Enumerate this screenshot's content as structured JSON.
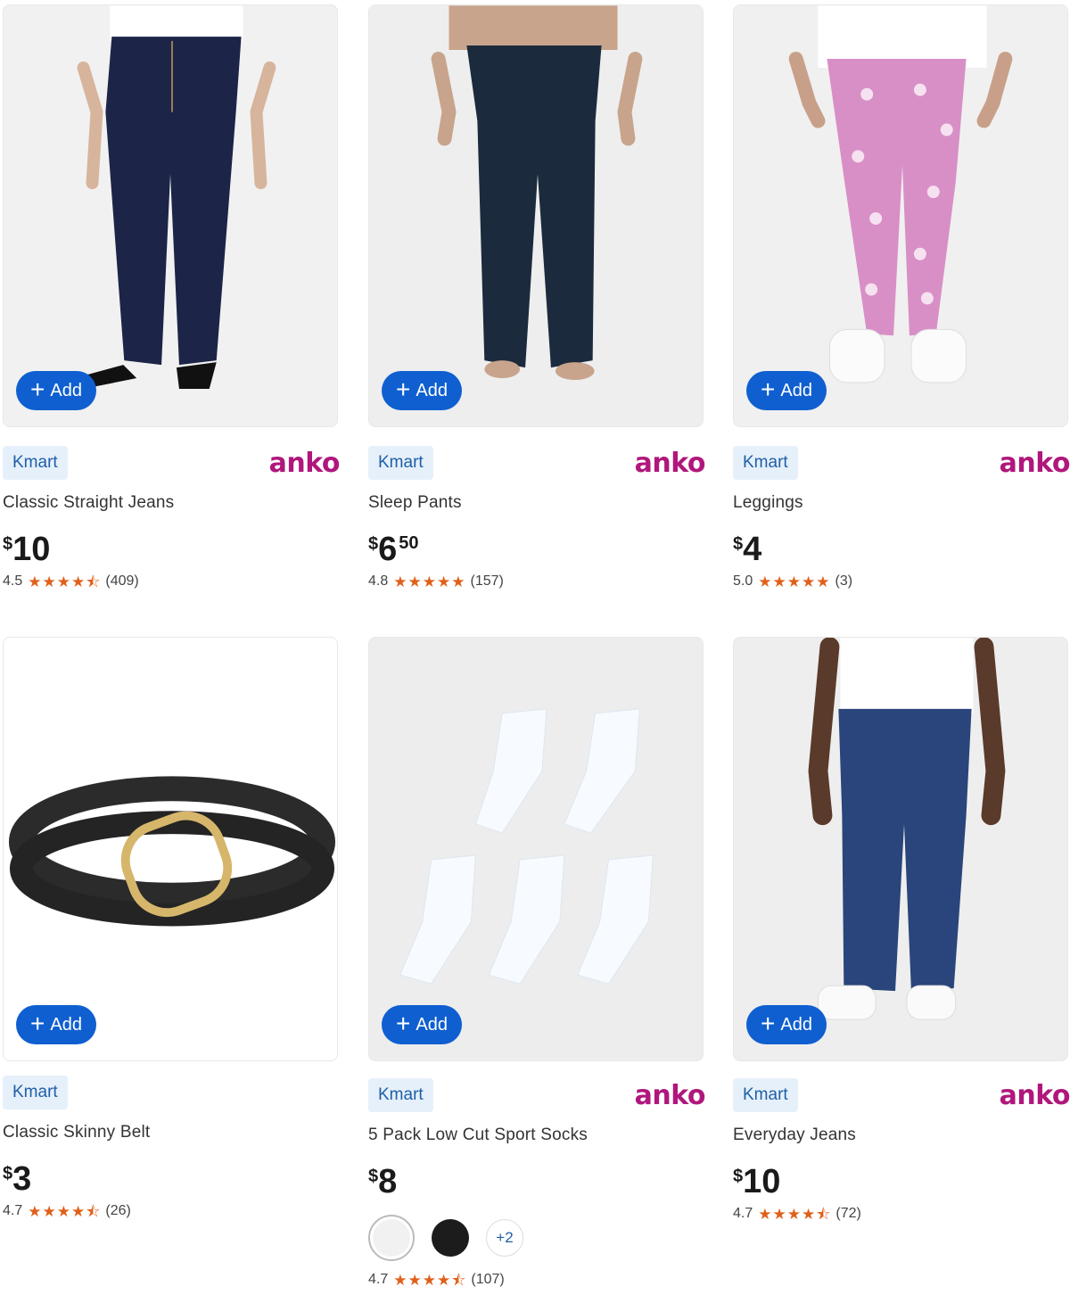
{
  "accent_color": "#0f5fd0",
  "brand_color": "#b0177c",
  "star_color": "#e0601a",
  "products": [
    {
      "add_label": "Add",
      "store": "Kmart",
      "brand": "anko",
      "title": "Classic Straight Jeans",
      "price_currency": "$",
      "price_dollars": "10",
      "price_cents": "",
      "rating": "4.5",
      "stars": 4.5,
      "reviews": "(409)",
      "image_icon": "womens-jeans-image"
    },
    {
      "add_label": "Add",
      "store": "Kmart",
      "brand": "anko",
      "title": "Sleep Pants",
      "price_currency": "$",
      "price_dollars": "6",
      "price_cents": "50",
      "rating": "4.8",
      "stars": 5,
      "reviews": "(157)",
      "image_icon": "sleep-pants-image"
    },
    {
      "add_label": "Add",
      "store": "Kmart",
      "brand": "anko",
      "title": "Leggings",
      "price_currency": "$",
      "price_dollars": "4",
      "price_cents": "",
      "rating": "5.0",
      "stars": 5,
      "reviews": "(3)",
      "image_icon": "heart-leggings-image"
    },
    {
      "add_label": "Add",
      "store": "Kmart",
      "brand": "",
      "title": "Classic Skinny Belt",
      "price_currency": "$",
      "price_dollars": "3",
      "price_cents": "",
      "rating": "4.7",
      "stars": 4.5,
      "reviews": "(26)",
      "image_icon": "belt-image"
    },
    {
      "add_label": "Add",
      "store": "Kmart",
      "brand": "anko",
      "title": "5 Pack Low Cut Sport Socks",
      "price_currency": "$",
      "price_dollars": "8",
      "price_cents": "",
      "rating": "4.7",
      "stars": 4.5,
      "reviews": "(107)",
      "image_icon": "socks-image",
      "swatch_more": "+2"
    },
    {
      "add_label": "Add",
      "store": "Kmart",
      "brand": "anko",
      "title": "Everyday Jeans",
      "price_currency": "$",
      "price_dollars": "10",
      "price_cents": "",
      "rating": "4.7",
      "stars": 4.5,
      "reviews": "(72)",
      "image_icon": "mens-jeans-image"
    }
  ]
}
